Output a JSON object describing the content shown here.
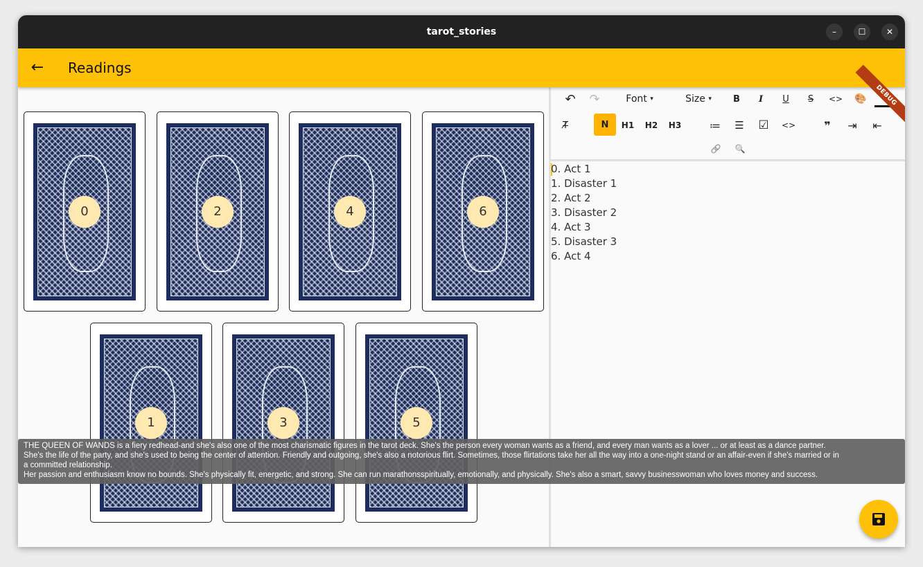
{
  "window": {
    "title": "tarot_stories",
    "controls": [
      {
        "name": "minimize",
        "glyph": "–"
      },
      {
        "name": "maximize",
        "glyph": "☐"
      },
      {
        "name": "close",
        "glyph": "✕"
      }
    ]
  },
  "appbar": {
    "back_glyph": "←",
    "title": "Readings",
    "debug_banner": "DEBUG"
  },
  "cards": [
    {
      "number": "0"
    },
    {
      "number": "2"
    },
    {
      "number": "4"
    },
    {
      "number": "6"
    },
    {
      "number": "1"
    },
    {
      "number": "3"
    },
    {
      "number": "5"
    }
  ],
  "tooltip": {
    "lines": [
      "THE QUEEN OF WANDS is a fiery redhead-and she's also one of the most charismatic figures in the tarot deck. She's the person every woman wants as a friend, and every man wants as a lover ... or at least as a dance partner.",
      "She's the life of the party, and she's used to being the center of attention. Friendly and outgoing, she's also a notorious flirt. Sometimes, those flirtations take her all the way into a one-night stand or an affair-even if she's married or in",
      "a committed relationship.",
      "Her passion and enthusiasm know no bounds. She's physically fit, energetic, and strong. She can run marathonsspiritually, emotionally, and physically. She's also a smart, savvy businesswoman who loves money and success."
    ]
  },
  "editor": {
    "toolbar": {
      "undo": "↶",
      "redo": "↷",
      "font_label": "Font",
      "size_label": "Size",
      "dropdown_glyph": "▾",
      "bold": "B",
      "italic": "I",
      "underline": "U",
      "strikethrough": "S",
      "inline_code": "<>",
      "text_color": "🎨",
      "background_color": "◈",
      "clear_format": "T̸",
      "normal": "N",
      "h1": "H1",
      "h2": "H2",
      "h3": "H3",
      "ordered_list": "≔",
      "bullet_list": "☰",
      "checkbox": "☑",
      "code_block": "<>",
      "quote": "❞",
      "indent": "⇥",
      "outdent": "⇤",
      "link": "🔗",
      "search": "🔍"
    },
    "lines": [
      "0. Act 1",
      "1. Disaster 1",
      "2. Act 2",
      "3. Disaster 2",
      "4. Act 3",
      "5. Disaster 3",
      "6. Act 4"
    ]
  },
  "fab": {
    "icon": "save-icon"
  },
  "colors": {
    "accent": "#ffc107",
    "selected": "#ffb300",
    "card_back": "#1c2d5e",
    "number_badge": "#ffe9b0",
    "titlebar": "#222222",
    "debug": "#b33c13"
  }
}
